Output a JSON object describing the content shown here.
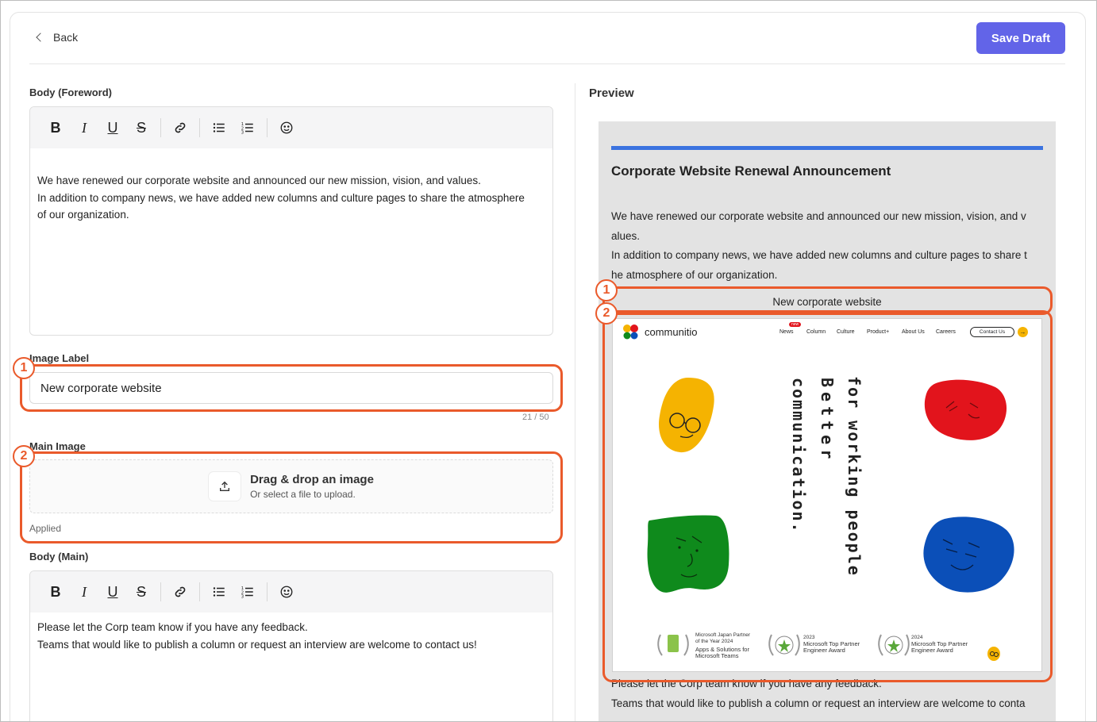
{
  "header": {
    "back_label": "Back",
    "save_label": "Save Draft"
  },
  "editor_foreword": {
    "label": "Body (Foreword)",
    "lines": [
      "We have renewed our corporate website and announced our new mission, vision, and values.",
      "In addition to company news, we have added new columns and culture pages to share the atmosphere",
      "of our organization."
    ]
  },
  "image_label_field": {
    "label": "Image Label",
    "value": "New corporate website",
    "counter": "21 / 50"
  },
  "main_image": {
    "label": "Main Image",
    "title": "Drag & drop an image",
    "subtitle": "Or select a file to upload.",
    "status": "Applied"
  },
  "editor_main": {
    "label": "Body (Main)",
    "lines": [
      "Please let the Corp team know if you have any feedback.",
      "Teams that would like to publish a column or request an interview are welcome to contact us!"
    ]
  },
  "toolbar_icons": [
    "bold-icon",
    "italic-icon",
    "underline-icon",
    "strikethrough-icon",
    "link-icon",
    "bullet-list-icon",
    "numbered-list-icon",
    "emoji-icon"
  ],
  "preview": {
    "title": "Preview",
    "heading": "Corporate Website Renewal Announcement",
    "foreword_lines": [
      "We have renewed our corporate website and announced our new mission, vision, and v",
      "alues.",
      "In addition to company news, we have added new columns and culture pages to share t",
      "he atmosphere of our organization."
    ],
    "caption": "New corporate website",
    "main_lines": [
      "Please let the Corp team know if you have any feedback.",
      "Teams that would like to publish a column or request an interview are welcome to conta"
    ],
    "site": {
      "logo": "communitio",
      "nav_badge": "new",
      "nav": [
        "News",
        "Column",
        "Culture",
        "Product+",
        "About Us",
        "Careers"
      ],
      "contact": "Contact Us",
      "tagline_col1": "for working people",
      "tagline_col2": "Better",
      "tagline_col3": "communication.",
      "awards": [
        {
          "l1": "Microsoft Japan Partner",
          "l2": "of the Year 2024",
          "l3": "Apps & Solutions for",
          "l4": "Microsoft Teams"
        },
        {
          "l1": "2023",
          "l2": "Microsoft Top Partner",
          "l3": "Engineer Award"
        },
        {
          "l1": "2024",
          "l2": "Microsoft Top Partner",
          "l3": "Engineer Award"
        }
      ]
    }
  },
  "callouts": {
    "one": "1",
    "two": "2"
  },
  "colors": {
    "accent": "#6264e8",
    "callout": "#ea5a2b",
    "preview_bar": "#3b73e0",
    "blob_yellow": "#f5b301",
    "blob_red": "#e2141c",
    "blob_green": "#0f8a1c",
    "blob_blue": "#0b4fb8"
  }
}
